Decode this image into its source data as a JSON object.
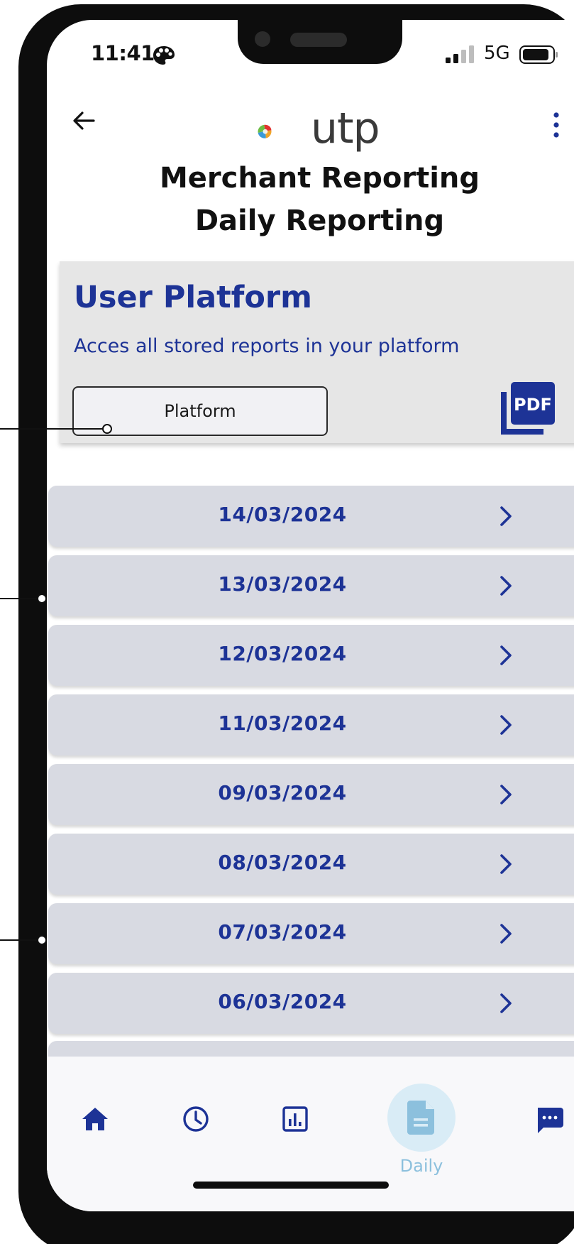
{
  "status_bar": {
    "time": "11:41",
    "network": "5G"
  },
  "header": {
    "logo_text": "utp",
    "title_line_1": "Merchant Reporting",
    "title_line_2": "Daily Reporting"
  },
  "card": {
    "title": "User Platform",
    "description": "Acces all stored reports in your platform",
    "button_label": "Platform",
    "pdf_label": "PDF"
  },
  "reports": [
    "14/03/2024",
    "13/03/2024",
    "12/03/2024",
    "11/03/2024",
    "09/03/2024",
    "08/03/2024",
    "07/03/2024",
    "06/03/2024"
  ],
  "bottom_nav": {
    "daily_label": "Daily",
    "icons": [
      "home-icon",
      "clock-icon",
      "bar-chart-icon",
      "document-icon",
      "chat-icon"
    ]
  },
  "colors": {
    "accent": "#1d3396",
    "row_bg": "#d8dae2",
    "card_bg": "#e6e6e6",
    "nav_active": "#8cc0dd"
  }
}
